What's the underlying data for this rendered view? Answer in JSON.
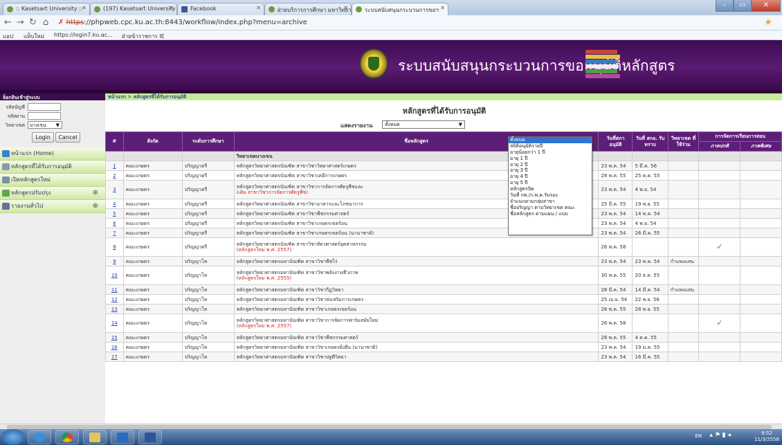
{
  "browser": {
    "tabs": [
      {
        "label": ":: Kasetsart University ::"
      },
      {
        "label": "(197) Kasetsart University"
      },
      {
        "label": "Facebook"
      },
      {
        "label": "ฝ่ายบริการการศึกษา มหาวิทยาลัย"
      },
      {
        "label": "ระบบสนับสนุนกระบวนการขอฯ"
      }
    ],
    "url_scheme": "https",
    "url_rest": "://phpweb.cpc.ku.ac.th:8443/workflow/index.php?menu=archive",
    "bookmarks": [
      "แอป",
      "แท็บใหม่",
      "https://login7.ku.ac...",
      "ฝ่ายข้าราชการ IE"
    ]
  },
  "banner": {
    "title": "ระบบสนับสนุนกระบวนการขออนุมัติหลักสูตร"
  },
  "sidebar": {
    "login_header": "ล็อกอินเข้าสู่ระบบ",
    "username_label": "รหัสบัญชี",
    "password_label": "รหัสผ่าน",
    "campus_label": "วิทยาเขต",
    "campus_value": "บางเขน",
    "login_button": "Login",
    "cancel_button": "Cancel",
    "menu": [
      {
        "label": "หน้าแรก (Home)"
      },
      {
        "label": "หลักสูตรที่ได้รับการอนุมัติ"
      },
      {
        "label": "เปิดหลักสูตรใหม่"
      },
      {
        "label": "หลักสูตรปรับปรุง"
      },
      {
        "label": "รายงานทั่วไป"
      }
    ]
  },
  "main": {
    "breadcrumb_home": "หน้าแรก",
    "breadcrumb_sep": ">",
    "breadcrumb_current": "หลักสูตรที่ได้รับการอนุมัติ",
    "page_title": "หลักสูตรที่ได้รับการอนุมัติ",
    "report_label": "แสดงรายงาน",
    "report_value": "ทั้งหมด",
    "dropdown_options": [
      "ทั้งหมด",
      "สถิติอนุมัติรายปี",
      "อายุน้อยกว่า 1 ปี",
      "อายุ 1 ปี",
      "อายุ 2 ปี",
      "อายุ 3 ปี",
      "อายุ 4 ปี",
      "อายุ 5 ปี",
      "หลักสูตรปิด",
      "วันที่ กพ./ก.พ.ค.รับรอง",
      "จำแนกตามกลุ่มสาขา",
      "ชื่อปริญญา ตามวิทยาเขต คณะ",
      "ชื่อหลักสูตร ตามแผน / แบบ"
    ],
    "columns": {
      "no": "#",
      "faculty": "สังกัด",
      "level": "ระดับการศึกษา",
      "name": "ชื่อหลักสูตร",
      "council_date": "วันที่สภาอนุมัติ",
      "ohec_date": "วันที่ สกอ. รับทราบ",
      "campus": "วิทยาเขต ที่ใช้ร่วม",
      "teaching": "การจัดการเรียนการสอน",
      "regular": "ภาคปกติ",
      "special": "ภาคพิเศษ"
    },
    "group_label": "วิทยาเขตบางเขน",
    "rows": [
      {
        "no": "1",
        "faculty": "คณะเกษตร",
        "level": "ปริญญาตรี",
        "name": "หลักสูตรวิทยาศาสตรบัณฑิต สาขาวิชาวิทยาศาสตร์เกษตร",
        "note": "",
        "council": "23 พ.ค. 54",
        "ohec": "5 มี.ค. 56",
        "campus": "",
        "regular": "",
        "special": ""
      },
      {
        "no": "2",
        "faculty": "คณะเกษตร",
        "level": "ปริญญาตรี",
        "name": "หลักสูตรวิทยาศาสตรบัณฑิต สาขาวิชาเคมีการเกษตร",
        "note": "",
        "council": "28 พ.ค. 55",
        "ohec": "25 ต.ค. 55",
        "campus": "",
        "regular": "",
        "special": ""
      },
      {
        "no": "3",
        "faculty": "คณะเกษตร",
        "level": "ปริญญาตรี",
        "name": "หลักสูตรวิทยาศาสตรบัณฑิต สาขาวิชาการจัดการศัตรูพืชและ",
        "note": "(เดิม สาขาวิชาการจัดการศัตรูพืช)",
        "council": "23 พ.ค. 54",
        "ohec": "4 พ.ย. 54",
        "campus": "",
        "regular": "",
        "special": ""
      },
      {
        "no": "4",
        "faculty": "คณะเกษตร",
        "level": "ปริญญาตรี",
        "name": "หลักสูตรวิทยาศาสตรบัณฑิต สาขาวิชาอาหารและโภชนาการ",
        "note": "",
        "council": "25 มี.ค. 55",
        "ohec": "19 พ.ย. 55",
        "campus": "",
        "regular": "",
        "special": ""
      },
      {
        "no": "5",
        "faculty": "คณะเกษตร",
        "level": "ปริญญาตรี",
        "name": "หลักสูตรวิทยาศาสตรบัณฑิต สาขาวิชาพืชกรรมศาสตร์",
        "note": "",
        "council": "23 พ.ค. 54",
        "ohec": "14 พ.ค. 54",
        "campus": "",
        "regular": "",
        "special": ""
      },
      {
        "no": "6",
        "faculty": "คณะเกษตร",
        "level": "ปริญญาตรี",
        "name": "หลักสูตรวิทยาศาสตรบัณฑิต สาขาวิชาเกษตรเขตร้อน",
        "note": "",
        "council": "23 พ.ค. 54",
        "ohec": "4 พ.ย. 54",
        "campus": "",
        "regular": "",
        "special": ""
      },
      {
        "no": "7",
        "faculty": "คณะเกษตร",
        "level": "ปริญญาตรี",
        "name": "หลักสูตรวิทยาศาสตรบัณฑิต สาขาวิชาเกษตรเขตร้อน (นานาชาติ)",
        "note": "",
        "council": "23 พ.ค. 54",
        "ohec": "26 มี.ค. 55",
        "campus": "",
        "regular": "",
        "special": ""
      },
      {
        "no": "8",
        "faculty": "คณะเกษตร",
        "level": "ปริญญาตรี",
        "name": "หลักสูตรวิทยาศาสตรบัณฑิต สาขาวิชาสัตวศาสตร์อุตสาหกรรม",
        "note": "(หลักสูตรใหม่ พ.ศ. 2557)",
        "council": "26 พ.ค. 58",
        "ohec": "",
        "campus": "",
        "regular": "✓",
        "special": ""
      },
      {
        "no": "9",
        "faculty": "คณะเกษตร",
        "level": "ปริญญาโท",
        "name": "หลักสูตรวิทยาศาสตรมหาบัณฑิต สาขาวิชาพืชไร่",
        "note": "",
        "council": "23 พ.ค. 54",
        "ohec": "23 พ.ค. 54",
        "campus": "กำแพงแสน",
        "regular": "",
        "special": ""
      },
      {
        "no": "10",
        "faculty": "คณะเกษตร",
        "level": "ปริญญาโท",
        "name": "หลักสูตรวิทยาศาสตรมหาบัณฑิต สาขาวิชาพลังงานชีวภาพ",
        "note": "(หลักสูตรใหม่ พ.ศ. 2555)",
        "council": "30 พ.ค. 55",
        "ohec": "20 ธ.ค. 55",
        "campus": "",
        "regular": "",
        "special": ""
      },
      {
        "no": "11",
        "faculty": "คณะเกษตร",
        "level": "ปริญญาโท",
        "name": "หลักสูตรวิทยาศาสตรมหาบัณฑิต สาขาวิชากีฏวิทยา",
        "note": "",
        "council": "28 มี.ค. 54",
        "ohec": "14 มี.ค. 54",
        "campus": "กำแพงแสน",
        "regular": "",
        "special": ""
      },
      {
        "no": "12",
        "faculty": "คณะเกษตร",
        "level": "ปริญญาโท",
        "name": "หลักสูตรวิทยาศาสตรมหาบัณฑิต สาขาวิชาส่งเสริมการเกษตร",
        "note": "",
        "council": "25 เม.ย. 54",
        "ohec": "22 พ.ย. 56",
        "campus": "",
        "regular": "",
        "special": ""
      },
      {
        "no": "13",
        "faculty": "คณะเกษตร",
        "level": "ปริญญาโท",
        "name": "หลักสูตรวิทยาศาสตรมหาบัณฑิต สาขาวิชาเกษตรเขตร้อน",
        "note": "",
        "council": "28 พ.ค. 55",
        "ohec": "28 พ.ย. 55",
        "campus": "",
        "regular": "",
        "special": ""
      },
      {
        "no": "14",
        "faculty": "คณะเกษตร",
        "level": "ปริญญาโท",
        "name": "หลักสูตรวิทยาศาสตรมหาบัณฑิต สาขาวิชาการจัดการฟาร์มสมัยใหม่",
        "note": "(หลักสูตรใหม่ พ.ศ. 2557)",
        "council": "26 พ.ค. 58",
        "ohec": "",
        "campus": "",
        "regular": "✓",
        "special": ""
      },
      {
        "no": "15",
        "faculty": "คณะเกษตร",
        "level": "ปริญญาโท",
        "name": "หลักสูตรวิทยาศาสตรมหาบัณฑิต สาขาวิชาพืชกรรมศาสตร์",
        "note": "",
        "council": "28 พ.ค. 55",
        "ohec": "4 ต.ค. 55",
        "campus": "",
        "regular": "",
        "special": ""
      },
      {
        "no": "16",
        "faculty": "คณะเกษตร",
        "level": "ปริญญาโท",
        "name": "หลักสูตรวิทยาศาสตรมหาบัณฑิต สาขาวิชาเกษตรยั่งยืน (นานาชาติ)",
        "note": "",
        "council": "23 พ.ค. 54",
        "ohec": "19 ม.ค. 55",
        "campus": "",
        "regular": "",
        "special": ""
      },
      {
        "no": "17",
        "faculty": "คณะเกษตร",
        "level": "ปริญญาโท",
        "name": "หลักสูตรวิทยาศาสตรมหาบัณฑิต สาขาวิชาปฐพีวิทยา",
        "note": "",
        "council": "23 พ.ค. 54",
        "ohec": "16 มี.ค. 55",
        "campus": "",
        "regular": "",
        "special": ""
      }
    ]
  },
  "taskbar": {
    "lang": "EN",
    "time": "9:52",
    "date": "11/3/2558"
  }
}
